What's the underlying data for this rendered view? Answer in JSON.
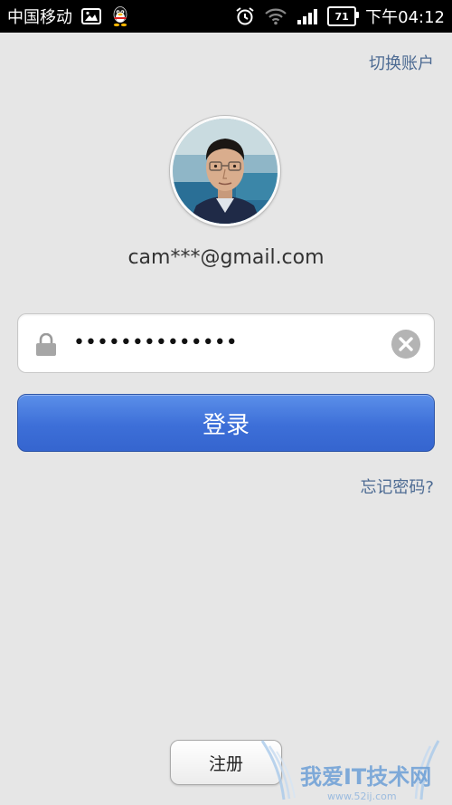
{
  "status_bar": {
    "carrier": "中国移动",
    "battery_level": "71",
    "time": "下午04:12",
    "icons": [
      "gallery-icon",
      "qq-penguin-icon",
      "alarm-icon",
      "wifi-icon",
      "signal-icon",
      "battery-icon"
    ]
  },
  "header": {
    "switch_account_label": "切换账户"
  },
  "account": {
    "email": "cam***@gmail.com"
  },
  "password": {
    "value": "••••••••••••••"
  },
  "login": {
    "button_label": "登录"
  },
  "forgot_password_label": "忘记密码?",
  "register_button_label": "注册",
  "colors": {
    "background": "#e6e6e6",
    "link": "#4d6b93",
    "primary_button": "#3d6fd8"
  }
}
